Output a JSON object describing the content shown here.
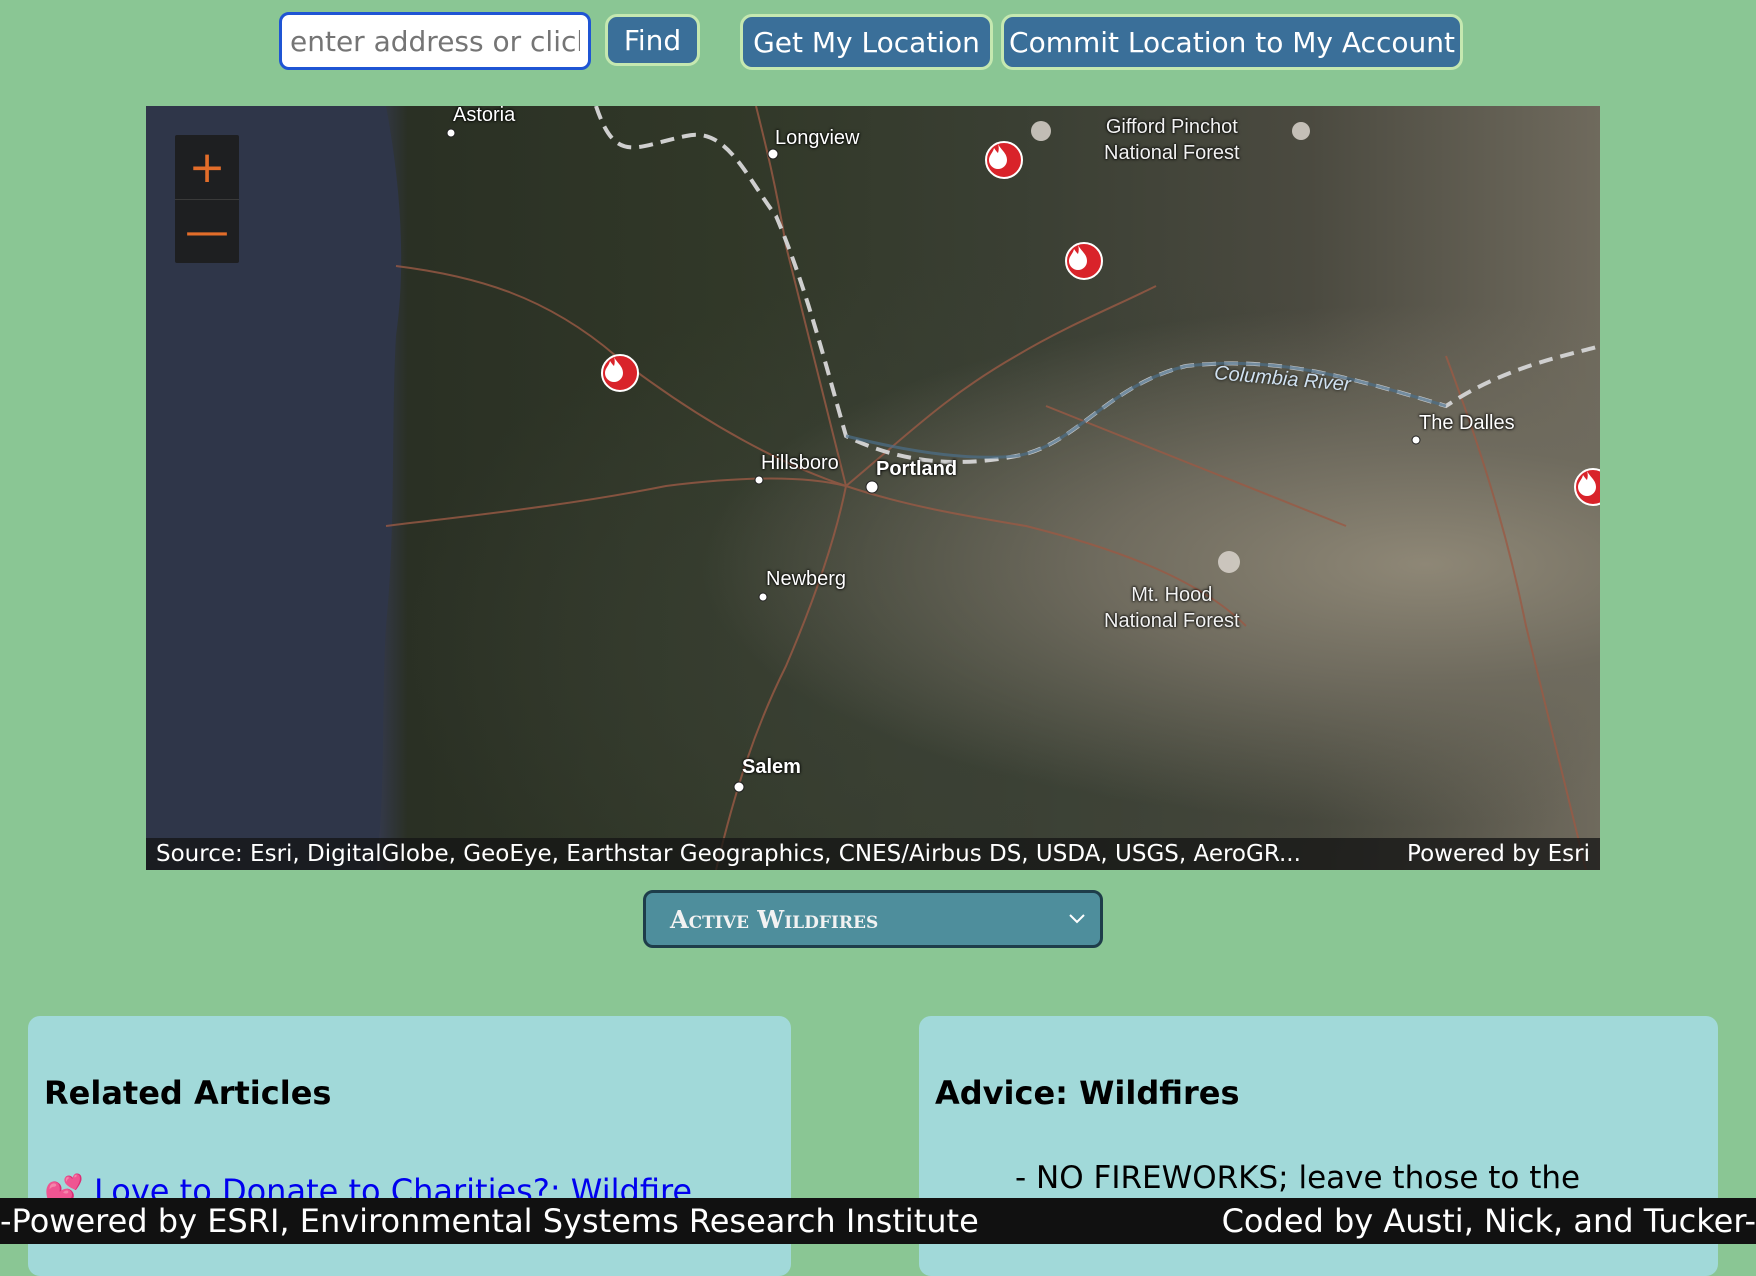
{
  "toolbar": {
    "search_placeholder": "enter address or click",
    "find_label": "Find",
    "get_location_label": "Get My Location",
    "commit_location_label": "Commit Location to My Account"
  },
  "map": {
    "zoom_in": "+",
    "zoom_out": "—",
    "places": {
      "astoria": "Astoria",
      "longview": "Longview",
      "gifford": "Gifford Pinchot\nNational Forest",
      "columbia": "Columbia River",
      "the_dalles": "The Dalles",
      "hillsboro": "Hillsboro",
      "portland": "Portland",
      "newberg": "Newberg",
      "mt_hood": "Mt. Hood\nNational Forest",
      "salem": "Salem"
    },
    "fire_icon": "fire-icon",
    "attribution_source": "Source: Esri, DigitalGlobe, GeoEye, Earthstar Geographics, CNES/Airbus DS, USDA, USGS, AeroGR...",
    "attribution_powered": "Powered by Esri"
  },
  "layer_select": {
    "selected": "Active Wildfires"
  },
  "related": {
    "heading": "Related Articles",
    "emoji": "💕",
    "link_text": "Love to Donate to Charities?: Wildfire"
  },
  "advice": {
    "heading": "Advice: Wildfires",
    "item": "- NO FIREWORKS; leave those to the professionals"
  },
  "footer": {
    "left": "-Powered by ESRI, Environmental Systems Research Institute",
    "right": "Coded by Austi, Nick, and Tucker-"
  },
  "colors": {
    "page_bg": "#8ac694",
    "button_bg": "#3a6f99",
    "panel_bg": "#a1d9d9",
    "fire_marker": "#d9232a",
    "zoom_accent": "#e36d2a"
  }
}
